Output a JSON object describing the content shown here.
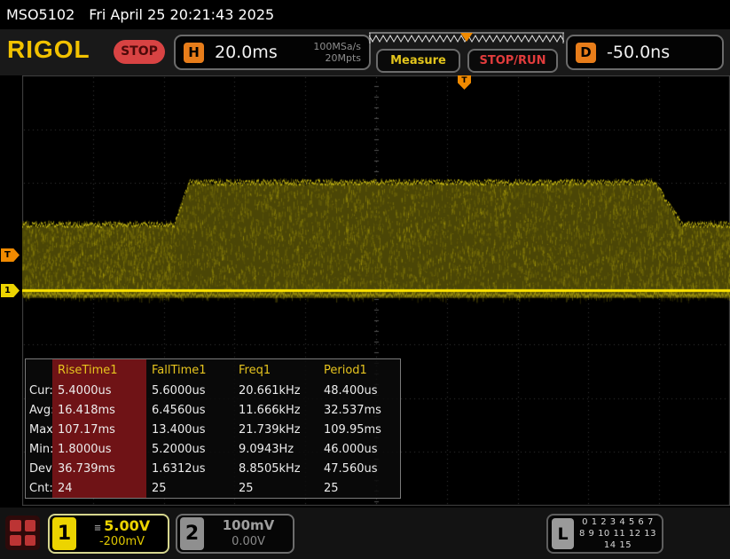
{
  "status_bar": {
    "model": "MSO5102",
    "datetime": "Fri April 25 20:21:43 2025"
  },
  "header": {
    "logo_text": "RIGOL",
    "run_state": "STOP",
    "horizontal": {
      "key": "H",
      "timebase": "20.0ms",
      "sample_rate": "100MSa/s",
      "memory_depth": "20Mpts"
    },
    "measure_button_label": "Measure",
    "stop_run_button_label": "STOP/RUN",
    "delay": {
      "key": "D",
      "value": "-50.0ns"
    }
  },
  "markers": {
    "trigger_position": "T",
    "trigger_level": "T",
    "channel1": "1"
  },
  "measurement_panel": {
    "columns": [
      "RiseTime1",
      "FallTime1",
      "Freq1",
      "Period1"
    ],
    "rows": [
      {
        "label": "Cur:",
        "values": [
          "5.4000us",
          "5.6000us",
          "20.661kHz",
          "48.400us"
        ]
      },
      {
        "label": "Avg:",
        "values": [
          "16.418ms",
          "6.4560us",
          "11.666kHz",
          "32.537ms"
        ]
      },
      {
        "label": "Max:",
        "values": [
          "107.17ms",
          "13.400us",
          "21.739kHz",
          "109.95ms"
        ]
      },
      {
        "label": "Min:",
        "values": [
          "1.8000us",
          "5.2000us",
          "9.0943Hz",
          "46.000us"
        ]
      },
      {
        "label": "Dev:",
        "values": [
          "36.739ms",
          "1.6312us",
          "8.8505kHz",
          "47.560us"
        ]
      },
      {
        "label": "Cnt:",
        "values": [
          "24",
          "25",
          "25",
          "25"
        ]
      }
    ]
  },
  "channels": {
    "ch1": {
      "number": "1",
      "scale": "5.00V",
      "offset": "-200mV",
      "coupling_icon": "≡"
    },
    "ch2": {
      "number": "2",
      "scale": "100mV",
      "offset": "0.00V"
    }
  },
  "digital": {
    "key": "L",
    "line1": "0 1 2 3 4 5 6 7",
    "line2": "8 9 10 11 12 13 14 15"
  },
  "colors": {
    "channel1_yellow": "#ecd400",
    "trigger_orange": "#f08a00",
    "stop_red": "#d84343",
    "measure_header_yellow": "#e6c41e",
    "selected_column_red": "#6f1316"
  },
  "waveform": {
    "baseline_frac": 0.499,
    "band_bottom_frac": 0.517,
    "top_low_frac": 0.345,
    "top_high_frac": 0.247,
    "rise_start_frac": 0.215,
    "rise_end_frac": 0.235,
    "fall_start_frac": 0.893,
    "fall_end_frac": 0.932,
    "color_bright": "#ffe400",
    "color_body": "#4f4a06"
  }
}
